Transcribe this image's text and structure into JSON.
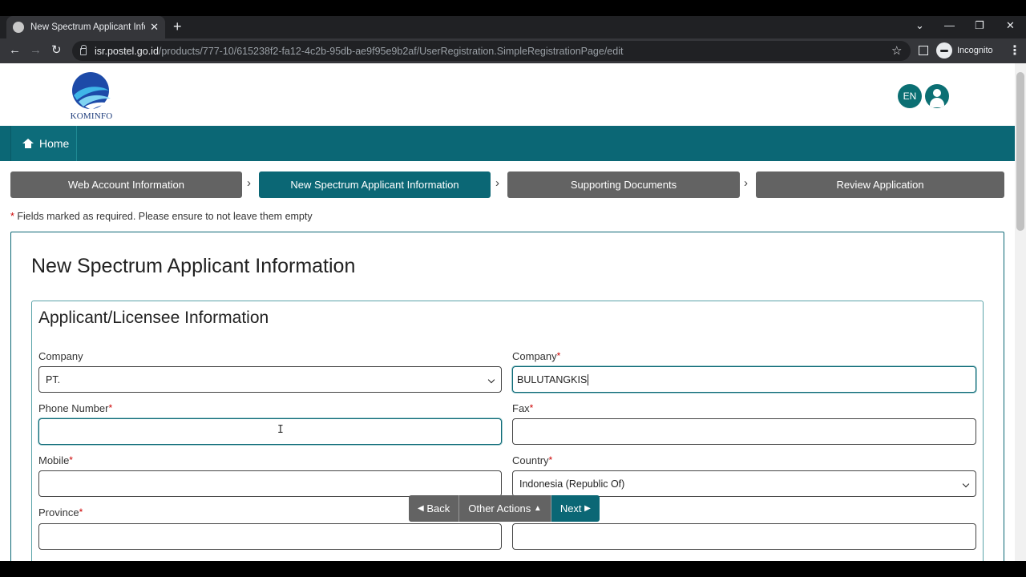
{
  "browser": {
    "tab_title": "New Spectrum Applicant Inform",
    "tab_close": "✕",
    "new_tab": "+",
    "url_host": "isr.postel.go.id",
    "url_path": "/products/777-10/615238f2-fa12-4c2b-95db-ae9f95e9b2af/UserRegistration.SimpleRegistrationPage/edit",
    "incognito_label": "Incognito",
    "controls": {
      "dropdown": "⌄",
      "minimize": "—",
      "restore": "❐",
      "close": "✕"
    },
    "nav": {
      "back": "←",
      "forward": "→",
      "reload": "↻"
    },
    "star": "☆",
    "menu": "⋮"
  },
  "header": {
    "logo_text": "KOMINFO",
    "lang": "EN"
  },
  "navbar": {
    "home_label": "Home"
  },
  "steps": [
    {
      "label": "Web Account Information",
      "state": "inactive"
    },
    {
      "label": "New Spectrum Applicant Information",
      "state": "active"
    },
    {
      "label": "Supporting Documents",
      "state": "inactive"
    },
    {
      "label": "Review Application",
      "state": "inactive"
    }
  ],
  "step_separator": "›",
  "required_note": "Fields marked as required. Please ensure to not leave them empty",
  "required_mark": "*",
  "card_title": "New Spectrum Applicant Information",
  "section_title": "Applicant/Licensee Information",
  "form": {
    "company_prefix_label": "Company",
    "company_prefix_value": "PT.",
    "company_name_label": "Company",
    "company_name_value": "BULUTANGKIS",
    "phone_label": "Phone Number",
    "phone_value": "",
    "fax_label": "Fax",
    "fax_value": "",
    "mobile_label": "Mobile",
    "mobile_value": "",
    "country_label": "Country",
    "country_value": "Indonesia (Republic Of)",
    "province_label": "Province",
    "province_value": "",
    "extra_value": ""
  },
  "actions": {
    "back": "Back",
    "other": "Other Actions",
    "next": "Next"
  },
  "colors": {
    "teal": "#0b6775",
    "step_inactive": "#636363",
    "required": "#cc0000"
  }
}
